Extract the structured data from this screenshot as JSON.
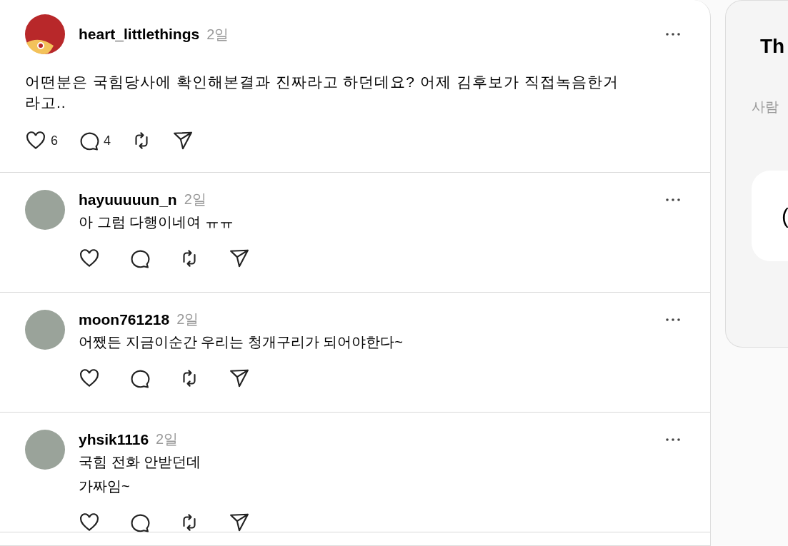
{
  "post": {
    "username": "heart_littlethings",
    "time": "2일",
    "text": "어떤분은 국힘당사에 확인해본결과 진짜라고 하던데요? 어제 김후보가 직접녹음한거라고..",
    "likes": "6",
    "comments": "4"
  },
  "replies": [
    {
      "username": "hayuuuuun_n",
      "time": "2일",
      "lines": [
        "아 그럼 다행이네여 ㅠㅠ"
      ]
    },
    {
      "username": "moon761218",
      "time": "2일",
      "lines": [
        "어쨌든 지금이순간 우리는 청개구리가 되어야한다~"
      ]
    },
    {
      "username": "yhsik1116",
      "time": "2일",
      "lines": [
        "국힘 전화 안받던데",
        "가짜임~"
      ]
    }
  ],
  "side_card": {
    "title": "Th",
    "subtitle": "사람",
    "inner_text": "("
  }
}
